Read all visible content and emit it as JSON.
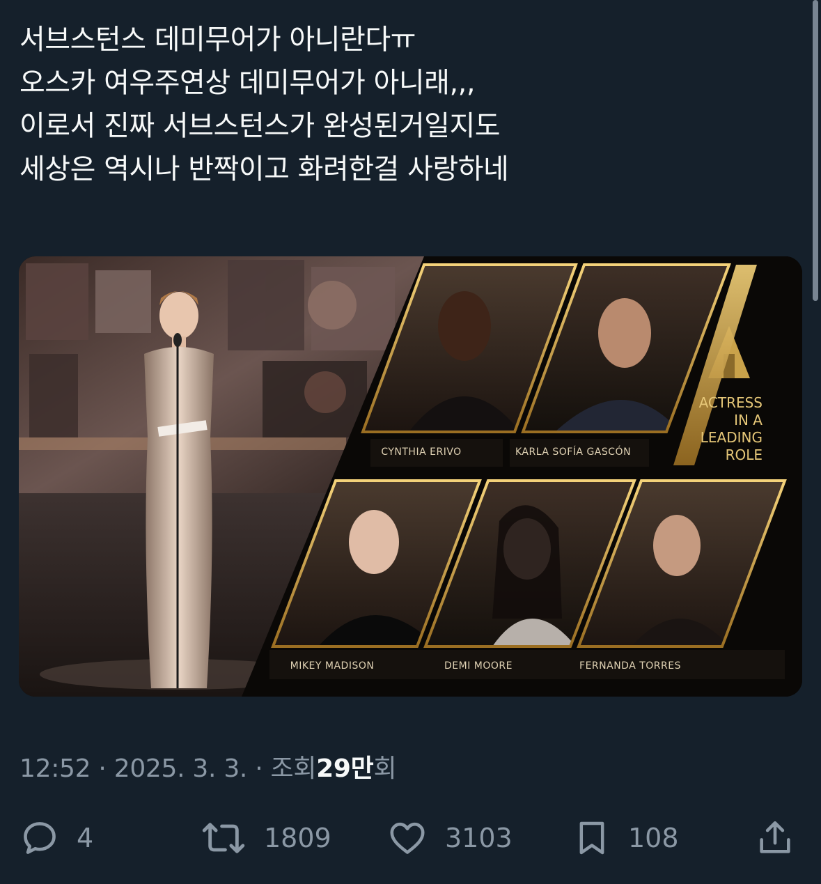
{
  "tweet": {
    "lines": [
      "서브스턴스 데미무어가 아니란다ㅠ",
      "오스카 여우주연상 데미무어가 아니래,,,",
      "이로서 진짜 서브스턴스가 완성된거일지도",
      "세상은 역시나 반짝이고 화려한걸 사랑하네"
    ]
  },
  "media": {
    "heading_lines": [
      "ACTRESS",
      "IN A",
      "LEADING",
      "ROLE"
    ],
    "nominees": [
      "CYNTHIA ERIVO",
      "KARLA SOFÍA GASCÓN",
      "MIKEY MADISON",
      "DEMI MOORE",
      "FERNANDA TORRES"
    ]
  },
  "meta": {
    "time": "12:52",
    "separator": "·",
    "date": "2025. 3. 3.",
    "views_label": "조회",
    "views_count": "29",
    "views_unit": "만",
    "views_suffix": "회"
  },
  "actions": {
    "replies": "4",
    "retweets": "1809",
    "likes": "3103",
    "bookmarks": "108"
  },
  "icons": {
    "reply": "reply-icon",
    "retweet": "retweet-icon",
    "like": "heart-icon",
    "bookmark": "bookmark-icon",
    "share": "share-icon"
  },
  "colors": {
    "background": "#15202b",
    "text": "#f7f9f9",
    "secondary": "#8b98a5",
    "gold": "#c9a24a"
  }
}
